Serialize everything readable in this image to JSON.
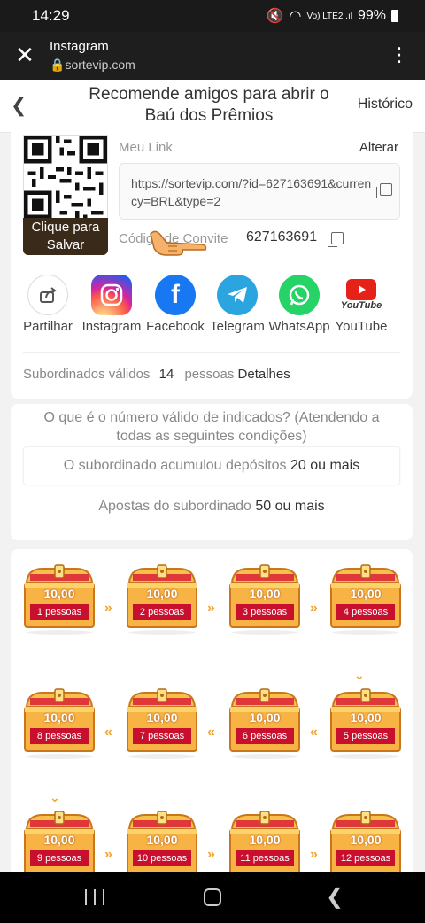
{
  "status_bar": {
    "time": "14:29",
    "icons_text": "Vo) LTE2 .ıl",
    "battery": "99%"
  },
  "browser": {
    "title": "Instagram",
    "url": "sortevip.com",
    "close_icon": "close-icon",
    "menu_icon": "kebab-menu-icon"
  },
  "header": {
    "title": "Recomende amigos para abrir o Baú dos Prêmios",
    "history": "Histórico"
  },
  "link_card": {
    "qr_save": "Clique para Salvar",
    "link_label": "Meu Link",
    "change_label": "Alterar",
    "link": "https://sortevip.com/?id=627163691&currency=BRL&type=2",
    "invite_label": "Código de Convite",
    "invite_code": "627163691"
  },
  "share": [
    {
      "label": "Partilhar",
      "icon": "share-icon"
    },
    {
      "label": "Instagram",
      "icon": "instagram-icon"
    },
    {
      "label": "Facebook",
      "icon": "facebook-icon"
    },
    {
      "label": "Telegram",
      "icon": "telegram-icon"
    },
    {
      "label": "WhatsApp",
      "icon": "whatsapp-icon"
    },
    {
      "label": "YouTube",
      "icon": "youtube-icon",
      "badge_text": "YouTube"
    }
  ],
  "subordinates": {
    "label": "Subordinados válidos",
    "count": "14",
    "unit": "pessoas",
    "details": "Detalhes"
  },
  "rules": {
    "title": "O que é o número válido de indicados? (Atendendo a todas as seguintes condições)",
    "deposit_text": "O subordinado acumulou depósitos",
    "deposit_value": "20 ou mais",
    "bet_text": "Apostas do subordinado",
    "bet_value": "50 ou mais"
  },
  "chests": {
    "value": "10,00",
    "row1": [
      "1 pessoas",
      "2 pessoas",
      "3 pessoas",
      "4 pessoas"
    ],
    "row2": [
      "8 pessoas",
      "7 pessoas",
      "6 pessoas",
      "5 pessoas"
    ],
    "row3": [
      "9 pessoas",
      "10 pessoas",
      "11 pessoas",
      "12 pessoas"
    ],
    "arrow_right": "»",
    "arrow_left": "«"
  },
  "colors": {
    "accent_red": "#c8102e",
    "chest_gold": "#f2a531",
    "facebook": "#1877f2",
    "whatsapp": "#25d366",
    "telegram": "#2aa5e0"
  }
}
